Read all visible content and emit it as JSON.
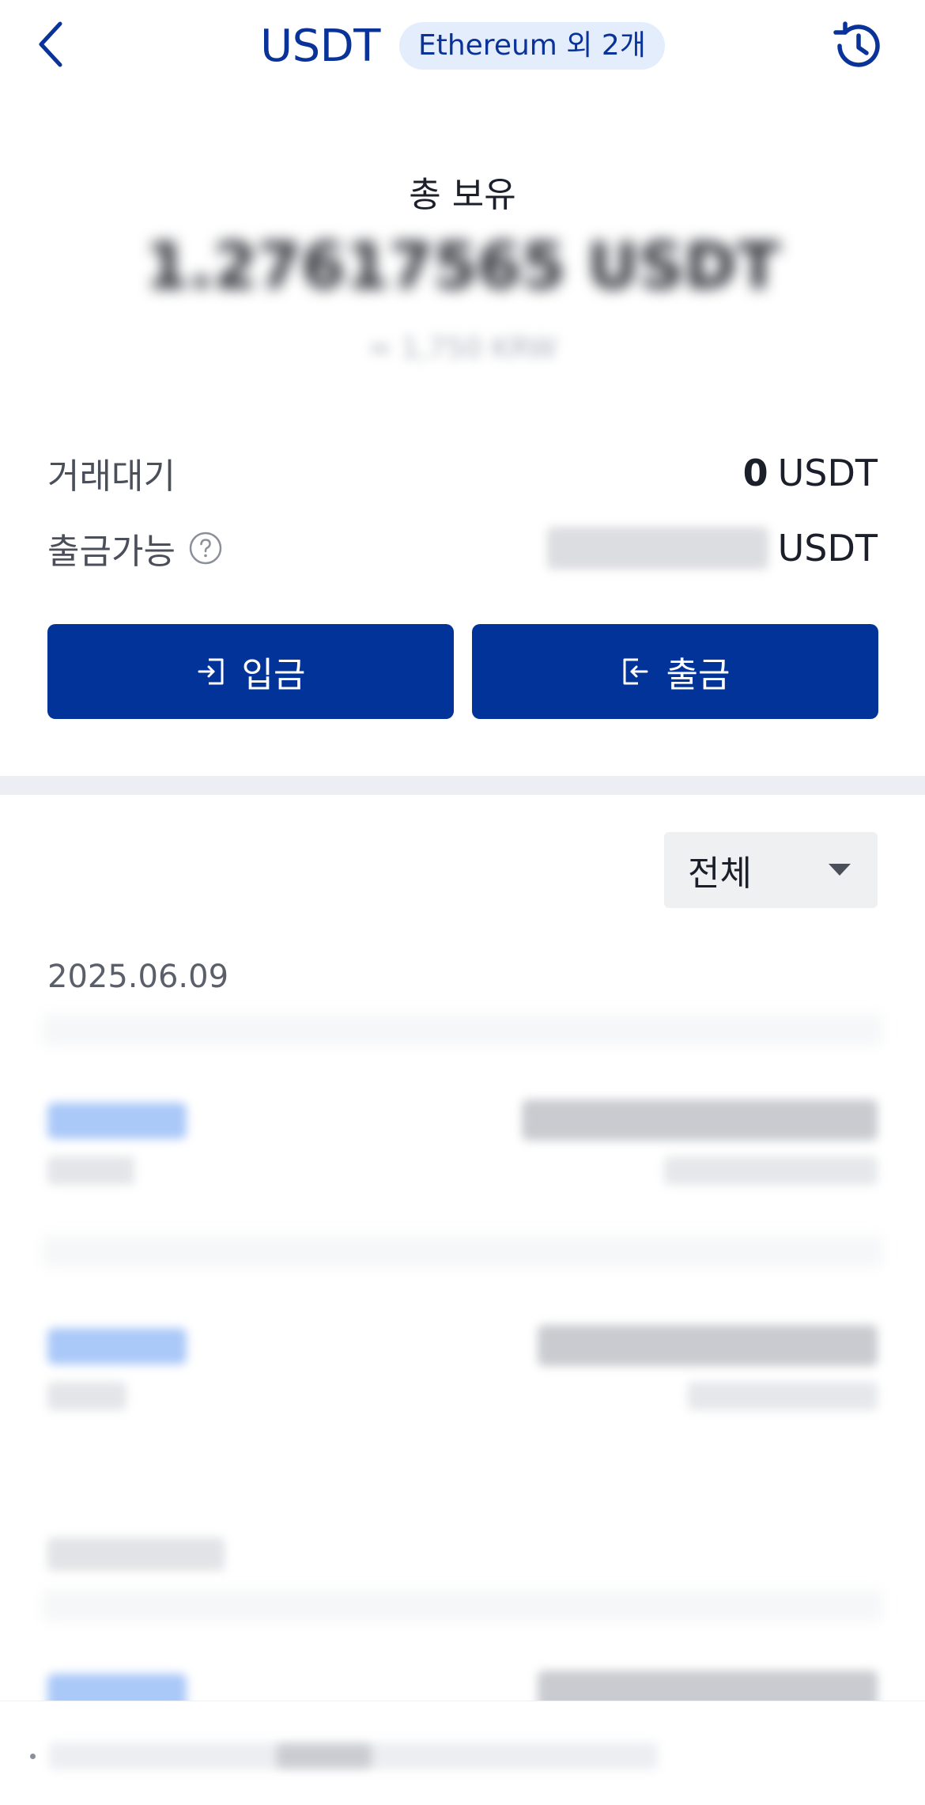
{
  "header": {
    "title": "USDT",
    "network_badge": "Ethereum 외 2개",
    "back_icon": "chevron-left-icon",
    "history_icon": "history-clock-icon"
  },
  "balance": {
    "label": "총 보유",
    "amount_obscured": "1.27617565 USDT",
    "krw_obscured": "≈ 1,750 KRW"
  },
  "details": {
    "pending_label": "거래대기",
    "pending_value": "0",
    "pending_unit": "USDT",
    "withdrawable_label": "출금가능",
    "withdrawable_unit": "USDT"
  },
  "actions": {
    "deposit_label": "입금",
    "withdraw_label": "출금"
  },
  "filter": {
    "selected": "전체"
  },
  "history": {
    "date": "2025.06.09"
  },
  "colors": {
    "brand_blue": "#023399",
    "title_blue": "#0a3399",
    "badge_bg": "#e3edfb",
    "divider": "#eceef3"
  }
}
